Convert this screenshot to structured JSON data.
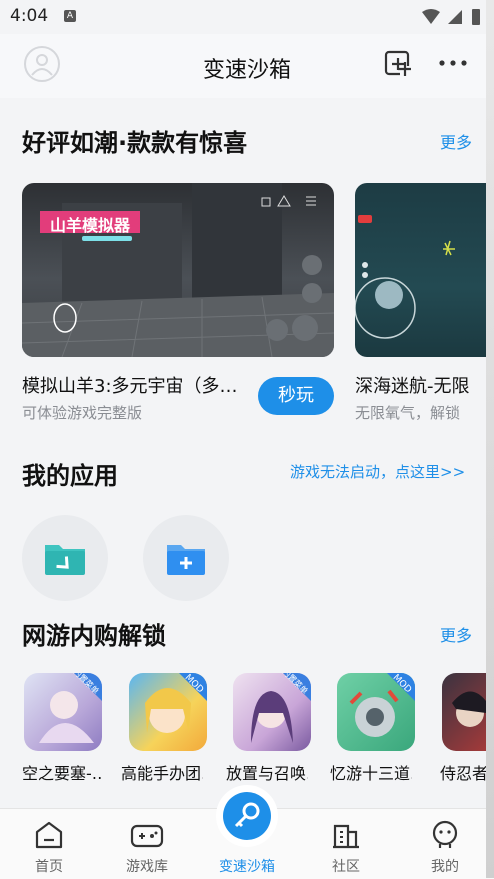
{
  "status": {
    "time": "4:04",
    "indicator": "A"
  },
  "header": {
    "title": "变速沙箱"
  },
  "section_featured": {
    "title": "好评如潮·款款有惊喜",
    "more": "更多",
    "cards": [
      {
        "title": "模拟山羊3:多元宇宙（多…",
        "subtitle": "可体验游戏完整版",
        "button": "秒玩",
        "banner": "山羊模拟器"
      },
      {
        "title": "深海迷航-无限",
        "subtitle": "无限氧气，解锁"
      }
    ]
  },
  "section_apps": {
    "title": "我的应用",
    "help_link": "游戏无法启动，点这里>>"
  },
  "section_unlock": {
    "title": "网游内购解锁",
    "more": "更多",
    "games": [
      {
        "name": "空之要塞-…",
        "badge": "内置菜单"
      },
      {
        "name": "高能手办团…",
        "badge": "MOD"
      },
      {
        "name": "放置与召唤…",
        "badge": "内置菜单"
      },
      {
        "name": "忆游十三道…",
        "badge": "MOD"
      },
      {
        "name": "侍忍者",
        "badge": ""
      }
    ]
  },
  "navbar": {
    "items": [
      {
        "label": "首页"
      },
      {
        "label": "游戏库"
      },
      {
        "label": "变速沙箱"
      },
      {
        "label": "社区"
      },
      {
        "label": "我的"
      }
    ]
  },
  "colors": {
    "accent": "#1e8fe8",
    "background": "#f3f4f6"
  }
}
